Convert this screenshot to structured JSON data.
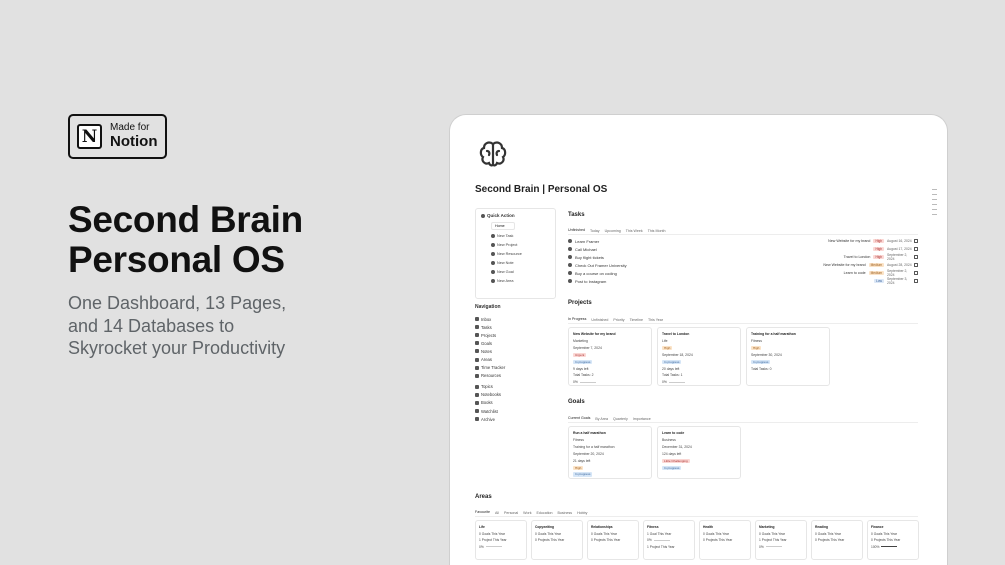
{
  "badge": {
    "small": "Made for",
    "big": "Notion",
    "logo_letter": "N"
  },
  "hero": {
    "title_line1": "Second Brain",
    "title_line2": "Personal OS",
    "sub_line1": "One Dashboard, 13 Pages,",
    "sub_line2": "and 14 Databases to",
    "sub_line3": "Skyrocket your Productivity"
  },
  "page": {
    "title": "Second Brain | Personal OS",
    "icon": "brain-icon"
  },
  "quick_action": {
    "title": "Quick Action",
    "home": "Home",
    "items": [
      "New Task",
      "New Project",
      "New Resource",
      "New Note",
      "New Goal",
      "New Area"
    ]
  },
  "navigation": {
    "title": "Navigation",
    "group1": [
      "Inbox",
      "Tasks",
      "Projects",
      "Goals",
      "Notes",
      "Areas",
      "Time Tracker",
      "Resources"
    ],
    "group2": [
      "Topics",
      "Notebooks",
      "Books",
      "Watchlist",
      "Archive"
    ]
  },
  "tasks": {
    "title": "Tasks",
    "tabs": [
      "Unfinished",
      "Today",
      "Upcoming",
      "This Week",
      "This Month"
    ],
    "rows": [
      {
        "name": "Learn Framer",
        "project": "New Website for my brand",
        "priority": "High",
        "date": "August 16, 2024"
      },
      {
        "name": "Call Michael",
        "project": "",
        "priority": "High",
        "date": "August 17, 2024"
      },
      {
        "name": "Buy flight tickets",
        "project": "Travel to London",
        "priority": "High",
        "date": "September 2, 2024"
      },
      {
        "name": "Check Out Framer University",
        "project": "New Website for my brand",
        "priority": "Medium",
        "date": "August 28, 2024"
      },
      {
        "name": "Buy a course on coding",
        "project": "Learn to code",
        "priority": "Medium",
        "date": "September 2, 2024"
      },
      {
        "name": "Post to Instagram",
        "project": "",
        "priority": "Low",
        "date": "September 3, 2024"
      }
    ]
  },
  "projects": {
    "title": "Projects",
    "tabs": [
      "In Progress",
      "Unfinished",
      "Priority",
      "Timeline",
      "This Year"
    ],
    "cards": [
      {
        "name": "New Website for my brand",
        "area": "Marketing",
        "date": "September 7, 2024",
        "priority": "Urgent",
        "status": "In progress",
        "days": "9 days left",
        "tasks": "Total Tasks: 2",
        "pct": "0%"
      },
      {
        "name": "Travel to London",
        "area": "Life",
        "date": "September 18, 2024",
        "priority": "High",
        "status": "In progress",
        "days": "20 days left",
        "tasks": "Total Tasks: 1",
        "pct": "0%"
      },
      {
        "name": "Training for a half marathon",
        "area": "Fitness",
        "date": "September 30, 2024",
        "priority": "High",
        "status": "In progress",
        "days": "",
        "tasks": "Total Tasks: 0",
        "pct": ""
      }
    ]
  },
  "goals": {
    "title": "Goals",
    "tabs": [
      "Current Goals",
      "By Area",
      "Quarterly",
      "Importance"
    ],
    "cards": [
      {
        "name": "Run a half marathon",
        "area": "Fitness",
        "project": "Training for a half marathon",
        "date": "September 20, 2024",
        "days": "21 days left",
        "priority": "High",
        "status": "In progress"
      },
      {
        "name": "Learn to code",
        "area": "Business",
        "project": "",
        "date": "December 31, 2024",
        "days": "124 days left",
        "priority": "Little Challenging",
        "status": "In progress"
      }
    ]
  },
  "areas": {
    "title": "Areas",
    "tabs": [
      "Favourite",
      "All",
      "Personal",
      "Work",
      "Education",
      "Business",
      "Hobby"
    ],
    "cards": [
      {
        "name": "Life",
        "goals": "0 Goals This Year",
        "projects": "1 Project This Year",
        "pct": "0%"
      },
      {
        "name": "Copywriting",
        "goals": "0 Goals This Year",
        "projects": "0 Projects This Year",
        "pct": ""
      },
      {
        "name": "Relationships",
        "goals": "0 Goals This Year",
        "projects": "0 Projects This Year",
        "pct": ""
      },
      {
        "name": "Fitness",
        "goals": "1 Goal This Year",
        "projects": "1 Project This Year",
        "pct": "0%"
      },
      {
        "name": "Health",
        "goals": "0 Goals This Year",
        "projects": "0 Projects This Year",
        "pct": ""
      },
      {
        "name": "Marketing",
        "goals": "0 Goals This Year",
        "projects": "1 Project This Year",
        "pct": "0%"
      },
      {
        "name": "Reading",
        "goals": "0 Goals This Year",
        "projects": "0 Projects This Year",
        "pct": ""
      },
      {
        "name": "Finance",
        "goals": "0 Goals This Year",
        "projects": "0 Projects This Year",
        "pct": "100%"
      }
    ]
  }
}
